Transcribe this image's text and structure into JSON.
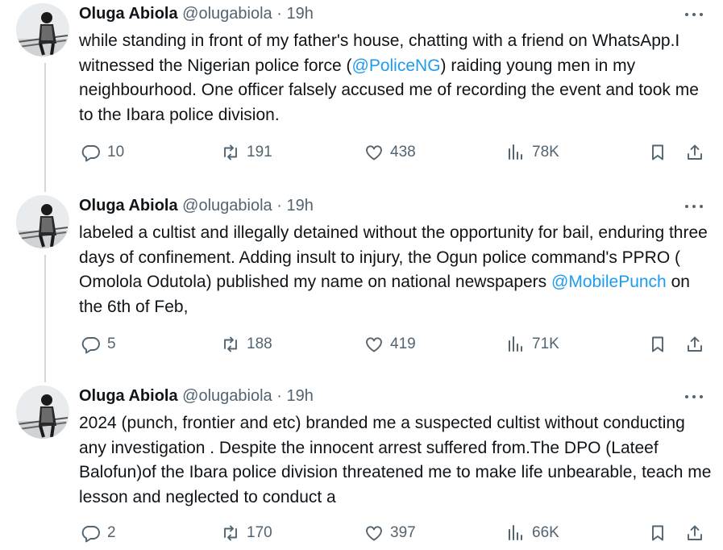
{
  "tweets": [
    {
      "name": "Oluga Abiola",
      "handle": "@olugabiola",
      "sep": "·",
      "time": "19h",
      "text": {
        "p1": "while standing in front of my father's house, chatting with a friend on WhatsApp.I witnessed the Nigerian police force (",
        "m1": "@PoliceNG",
        "p2": ") raiding young men in my neighbourhood. One officer falsely accused me of recording the event and took me to the Ibara police division."
      },
      "replies": "10",
      "reposts": "191",
      "likes": "438",
      "views": "78K"
    },
    {
      "name": "Oluga Abiola",
      "handle": "@olugabiola",
      "sep": "·",
      "time": "19h",
      "text": {
        "p1": "labeled a cultist and illegally detained without the opportunity for bail, enduring three days of confinement. Adding insult to injury, the Ogun police command's PPRO ( Omolola Odutola) published my name on national newspapers ",
        "m1": "@MobilePunch",
        "p2": " on the 6th of Feb,"
      },
      "replies": "5",
      "reposts": "188",
      "likes": "419",
      "views": "71K"
    },
    {
      "name": "Oluga Abiola",
      "handle": "@olugabiola",
      "sep": "·",
      "time": "19h",
      "text": {
        "p1": "2024 (punch, frontier and etc) branded me a suspected cultist without conducting any investigation . Despite the innocent arrest suffered from.The DPO (Lateef Balofun)of the Ibara police division threatened me to make life unbearable, teach me lesson and neglected to conduct a",
        "m1": "",
        "p2": ""
      },
      "replies": "2",
      "reposts": "170",
      "likes": "397",
      "views": "66K"
    }
  ],
  "icons": {
    "reply": "reply-icon",
    "repost": "repost-icon",
    "like": "heart-icon",
    "views": "views-icon",
    "bookmark": "bookmark-icon",
    "share": "share-icon",
    "more": "more-icon"
  },
  "colors": {
    "text": "#0f1419",
    "secondary": "#536471",
    "link": "#1d9bf0",
    "thread_line": "#cfd9de"
  }
}
